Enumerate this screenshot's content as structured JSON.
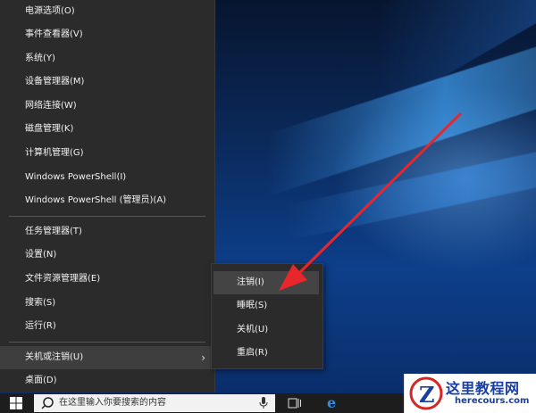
{
  "menu": {
    "items": [
      {
        "label": "电源选项(O)"
      },
      {
        "label": "事件查看器(V)"
      },
      {
        "label": "系统(Y)"
      },
      {
        "label": "设备管理器(M)"
      },
      {
        "label": "网络连接(W)"
      },
      {
        "label": "磁盘管理(K)"
      },
      {
        "label": "计算机管理(G)"
      },
      {
        "label": "Windows PowerShell(I)"
      },
      {
        "label": "Windows PowerShell (管理员)(A)"
      },
      {
        "label": "任务管理器(T)"
      },
      {
        "label": "设置(N)"
      },
      {
        "label": "文件资源管理器(E)"
      },
      {
        "label": "搜索(S)"
      },
      {
        "label": "运行(R)"
      },
      {
        "label": "关机或注销(U)"
      },
      {
        "label": "桌面(D)"
      }
    ],
    "submenu_chevron": "›"
  },
  "submenu": {
    "items": [
      {
        "label": "注销(I)"
      },
      {
        "label": "睡眠(S)"
      },
      {
        "label": "关机(U)"
      },
      {
        "label": "重启(R)"
      }
    ]
  },
  "taskbar": {
    "search_placeholder": "在这里输入你要搜索的内容",
    "edge_glyph": "e"
  },
  "watermark": {
    "title": "这里教程网",
    "url": "herecours.com"
  },
  "colors": {
    "menu_bg": "#2b2b2b",
    "menu_text": "#f2f2f2",
    "arrow": "#e8262b",
    "taskbar": "#1d1d1d",
    "watermark_blue": "#1a3f9e"
  },
  "icons": [
    "windows-start-icon",
    "search-icon",
    "microphone-icon",
    "task-view-icon",
    "edge-icon",
    "watermark-logo-icon",
    "chevron-right-icon",
    "red-arrow-annotation"
  ]
}
